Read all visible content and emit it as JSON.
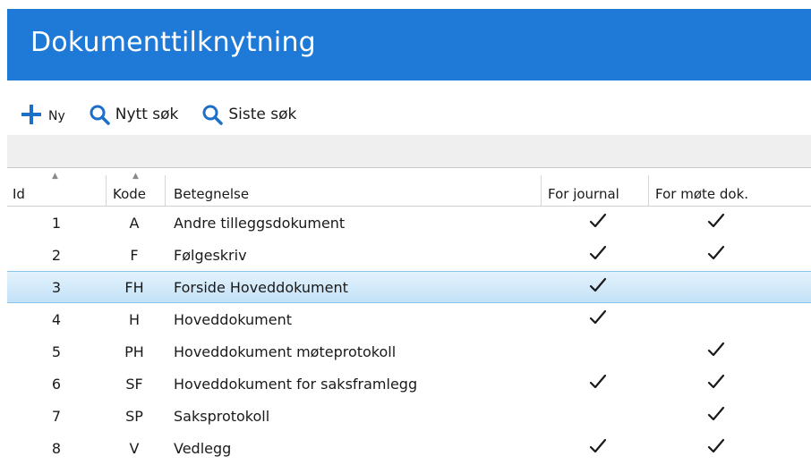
{
  "window": {
    "title": "Dokumenttilknytning"
  },
  "toolbar": {
    "new_label": "Ny",
    "new_search_label": "Nytt søk",
    "last_search_label": "Siste søk"
  },
  "columns": {
    "id": "Id",
    "kode": "Kode",
    "betegnelse": "Betegnelse",
    "for_journal": "For journal",
    "for_mote": "For møte dok."
  },
  "rows": [
    {
      "id": "1",
      "kode": "A",
      "betegnelse": "Andre tilleggsdokument",
      "for_journal": true,
      "for_mote": true,
      "selected": false
    },
    {
      "id": "2",
      "kode": "F",
      "betegnelse": "Følgeskriv",
      "for_journal": true,
      "for_mote": true,
      "selected": false
    },
    {
      "id": "3",
      "kode": "FH",
      "betegnelse": "Forside Hoveddokument",
      "for_journal": true,
      "for_mote": false,
      "selected": true
    },
    {
      "id": "4",
      "kode": "H",
      "betegnelse": "Hoveddokument",
      "for_journal": true,
      "for_mote": false,
      "selected": false
    },
    {
      "id": "5",
      "kode": "PH",
      "betegnelse": "Hoveddokument møteprotokoll",
      "for_journal": false,
      "for_mote": true,
      "selected": false
    },
    {
      "id": "6",
      "kode": "SF",
      "betegnelse": "Hoveddokument for saksframlegg",
      "for_journal": true,
      "for_mote": true,
      "selected": false
    },
    {
      "id": "7",
      "kode": "SP",
      "betegnelse": "Saksprotokoll",
      "for_journal": false,
      "for_mote": true,
      "selected": false
    },
    {
      "id": "8",
      "kode": "V",
      "betegnelse": "Vedlegg",
      "for_journal": true,
      "for_mote": true,
      "selected": false
    }
  ],
  "colors": {
    "accent": "#1e7ad6",
    "selection": "#c3e2f8",
    "toolbar_icon": "#1e6fc8"
  },
  "icons": {
    "new": "plus-icon",
    "search": "search-icon",
    "check": "check-icon",
    "sort": "sort-ascending-icon"
  }
}
